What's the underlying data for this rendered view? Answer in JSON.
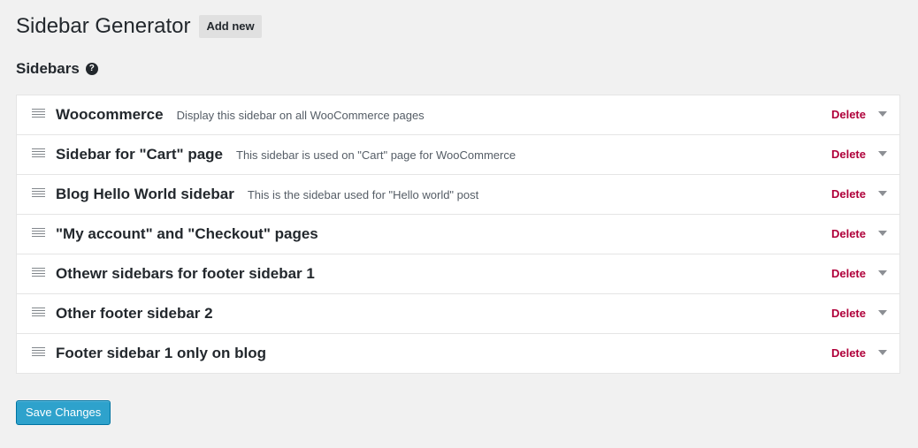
{
  "header": {
    "title": "Sidebar Generator",
    "add_new_label": "Add new"
  },
  "section": {
    "title": "Sidebars",
    "help_icon_glyph": "?"
  },
  "sidebars": [
    {
      "name": "Woocommerce",
      "description": "Display this sidebar on all WooCommerce pages",
      "delete_label": "Delete"
    },
    {
      "name": "Sidebar for \"Cart\" page",
      "description": "This sidebar is used on \"Cart\" page for WooCommerce",
      "delete_label": "Delete"
    },
    {
      "name": "Blog Hello World sidebar",
      "description": "This is the sidebar used for \"Hello world\" post",
      "delete_label": "Delete"
    },
    {
      "name": "\"My account\" and \"Checkout\" pages",
      "description": "",
      "delete_label": "Delete"
    },
    {
      "name": "Othewr sidebars for footer sidebar 1",
      "description": "",
      "delete_label": "Delete"
    },
    {
      "name": "Other footer sidebar 2",
      "description": "",
      "delete_label": "Delete"
    },
    {
      "name": "Footer sidebar 1 only on blog",
      "description": "",
      "delete_label": "Delete"
    }
  ],
  "footer": {
    "save_label": "Save Changes"
  },
  "colors": {
    "background": "#f1f1f1",
    "delete": "#b0003a",
    "primary_button": "#2ea2cc"
  },
  "icons": {
    "drag": "drag-handle-icon",
    "toggle": "chevron-down-icon",
    "help": "help-icon"
  }
}
